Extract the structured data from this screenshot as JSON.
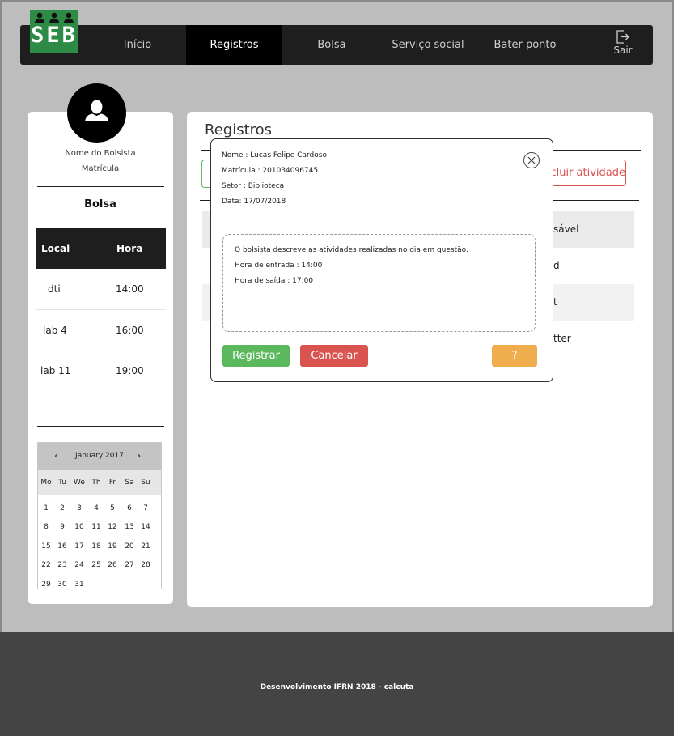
{
  "logo": {
    "text": "SEB"
  },
  "nav": {
    "items": [
      "Início",
      "Registros",
      "Bolsa",
      "Serviço social",
      "Bater ponto"
    ],
    "active": "Registros",
    "logout_label": "Sair"
  },
  "sidebar": {
    "name_label": "Nome do Bolsista",
    "matricula_label": "Matrícula",
    "section_title": "Bolsa",
    "table": {
      "headers": [
        "Local",
        "Hora"
      ],
      "rows": [
        {
          "local": "dti",
          "hora": "14:00"
        },
        {
          "local": "lab 4",
          "hora": "16:00"
        },
        {
          "local": "lab 11",
          "hora": "19:00"
        }
      ]
    },
    "calendar": {
      "month_label": "January 2017",
      "days_of_week": [
        "Mo",
        "Tu",
        "We",
        "Th",
        "Fr",
        "Sa",
        "Su"
      ],
      "weeks": [
        [
          "1",
          "2",
          "3",
          "4",
          "5",
          "6",
          "7"
        ],
        [
          "8",
          "9",
          "10",
          "11",
          "12",
          "13",
          "14"
        ],
        [
          "15",
          "16",
          "17",
          "18",
          "19",
          "20",
          "21"
        ],
        [
          "22",
          "23",
          "24",
          "25",
          "26",
          "27",
          "28"
        ],
        [
          "29",
          "30",
          "31",
          "",
          "",
          "",
          ""
        ]
      ]
    }
  },
  "main": {
    "title": "Registros",
    "excluir_label": "cluir atividade",
    "column_header_fragment": "sável",
    "row_fragments": [
      "d",
      "t",
      "tter"
    ]
  },
  "modal": {
    "nome": "Nome : Lucas Felipe Cardoso",
    "matricula": "Matrícula : 201034096745",
    "setor": "Setor : Biblioteca",
    "data": "Data: 17/07/2018",
    "description_lines": [
      "O bolsista descreve as atividades realizadas no dia em questão.",
      "Hora de entrada : 14:00",
      "Hora de saída : 17:00"
    ],
    "register_label": "Registrar",
    "cancel_label": "Cancelar",
    "help_label": "?"
  },
  "footer": {
    "text": "Desenvolvimento IFRN 2018 - calcuta"
  },
  "colors": {
    "nav_bg": "#1e1e1e",
    "logo_green": "#2e8b45",
    "success": "#5cb85c",
    "danger": "#d9534f",
    "warning": "#f0ad4e",
    "footer_bg": "#444444"
  }
}
